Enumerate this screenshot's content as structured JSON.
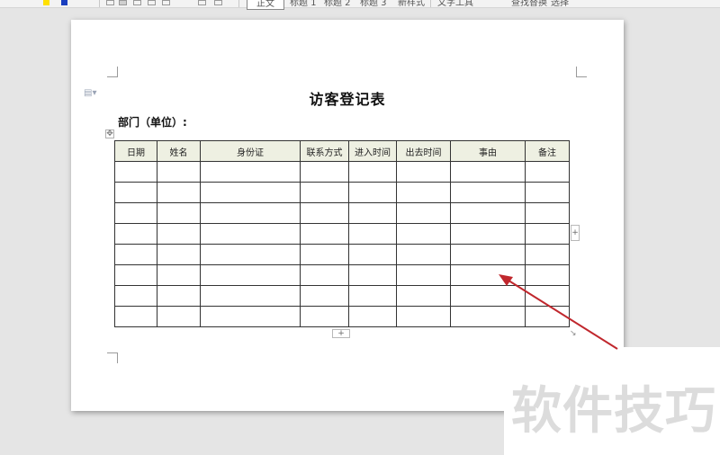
{
  "toolbar": {
    "style_normal": "正文",
    "style_h1": "标题 1",
    "style_h2": "标题 2",
    "style_h3": "标题 3",
    "new_style": "新样式",
    "text_tools": "文字工具",
    "find_replace": "查找替换",
    "select": "选择"
  },
  "document": {
    "title": "访客登记表",
    "department_label": "部门（单位）:",
    "table": {
      "headers": [
        "日期",
        "姓名",
        "身份证",
        "联系方式",
        "进入时间",
        "出去时间",
        "事由",
        "备注"
      ],
      "empty_row_count": 8
    },
    "add_col_symbol": "+",
    "add_row_symbol": "+",
    "move_handle_symbol": "✥"
  },
  "watermark": {
    "text": "软件技巧"
  },
  "colors": {
    "header_fill": "#eef0e2",
    "arrow": "#c0272d",
    "canvas": "#e5e5e5"
  }
}
